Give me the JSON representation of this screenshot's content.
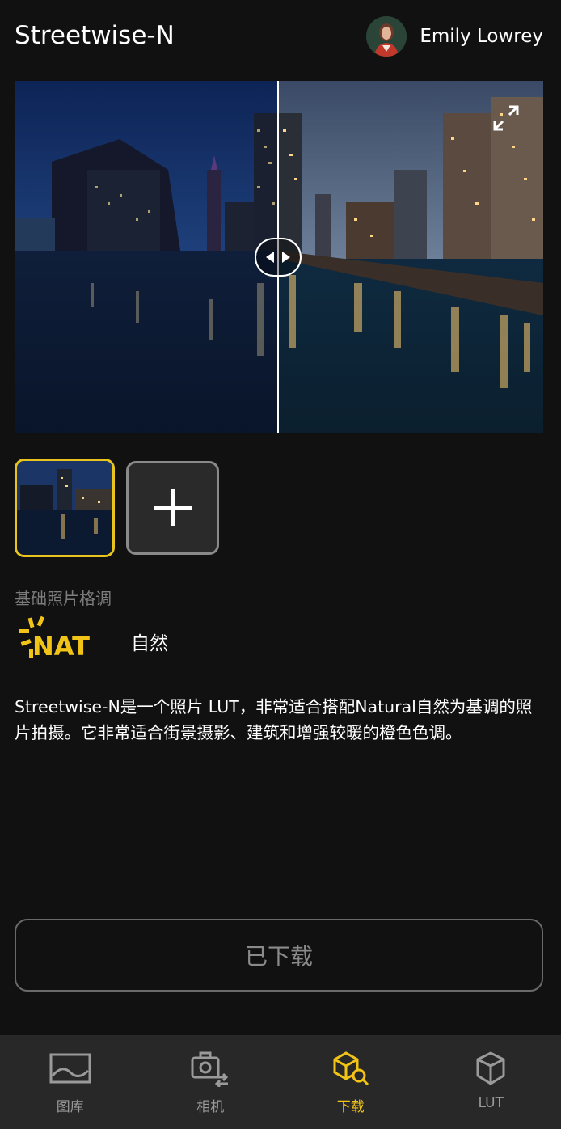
{
  "header": {
    "title": "Streetwise-N",
    "user_name": "Emily Lowrey"
  },
  "base_style": {
    "section_label": "基础照片格调",
    "logo_text": "NAT",
    "name": "自然"
  },
  "description": "Streetwise-N是一个照片 LUT，非常适合搭配Natural自然为基调的照片拍摄。它非常适合街景摄影、建筑和增强较暖的橙色色调。",
  "download_button": {
    "label": "已下载"
  },
  "bottom_nav": {
    "items": [
      {
        "label": "图库",
        "icon": "gallery-icon",
        "active": false
      },
      {
        "label": "相机",
        "icon": "camera-switch-icon",
        "active": false
      },
      {
        "label": "下载",
        "icon": "download-search-icon",
        "active": true
      },
      {
        "label": "LUT",
        "icon": "cube-icon",
        "active": false
      }
    ]
  },
  "colors": {
    "accent": "#f2c418",
    "background": "#111111",
    "nav_background": "#282828"
  }
}
